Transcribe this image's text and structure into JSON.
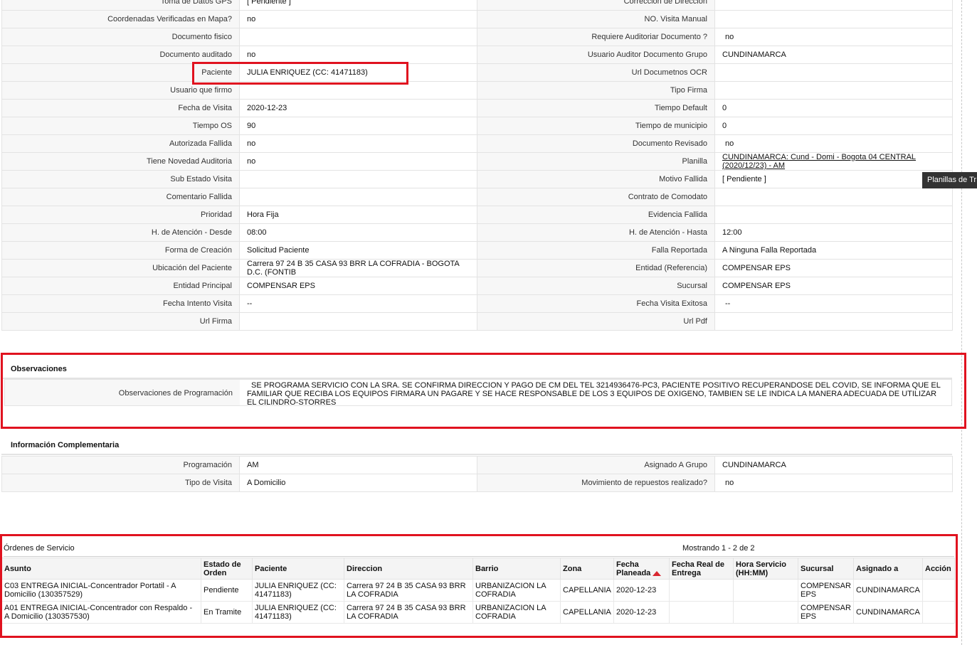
{
  "tooltip": "Planillas de Tr",
  "details": [
    [
      "Toma de Datos GPS",
      "[ Pendiente ]",
      "Corrección de Dirección",
      ""
    ],
    [
      "Coordenadas Verificadas en Mapa?",
      "no",
      "NO. Visita Manual",
      ""
    ],
    [
      "Documento fisico",
      "",
      "Requiere Auditoriar Documento ?",
      "no"
    ],
    [
      "Documento auditado",
      "no",
      "Usuario Auditor Documento Grupo",
      "CUNDINAMARCA"
    ],
    [
      "Paciente",
      "JULIA ENRIQUEZ (CC: 41471183)",
      "Url Documetnos OCR",
      ""
    ],
    [
      "Usuario que firmo",
      "",
      "Tipo Firma",
      ""
    ],
    [
      "Fecha de Visita",
      "2020-12-23",
      "Tiempo Default",
      "0"
    ],
    [
      "Tiempo OS",
      "90",
      "Tiempo de municipio",
      "0"
    ],
    [
      "Autorizada Fallida",
      "no",
      "Documento Revisado",
      "no"
    ],
    [
      "Tiene Novedad Auditoria",
      "no",
      "Planilla",
      "CUNDINAMARCA: Cund - Domi - Bogota 04 CENTRAL (2020/12/23) - AM"
    ],
    [
      "Sub Estado Visita",
      "",
      "Motivo Fallida",
      "[ Pendiente ]"
    ],
    [
      "Comentario Fallida",
      "",
      "Contrato de Comodato",
      ""
    ],
    [
      "Prioridad",
      "Hora Fija",
      "Evidencia Fallida",
      ""
    ],
    [
      "H. de Atención - Desde",
      "08:00",
      "H. de Atención - Hasta",
      "12:00"
    ],
    [
      "Forma de Creación",
      "Solicitud Paciente",
      "Falla Reportada",
      "A Ninguna Falla Reportada"
    ],
    [
      "Ubicación del Paciente",
      "Carrera 97 24 B 35 CASA 93 BRR LA COFRADIA - BOGOTA D.C. (FONTIB",
      "Entidad (Referencia)",
      "COMPENSAR EPS"
    ],
    [
      "Entidad Principal",
      "COMPENSAR EPS",
      "Sucursal",
      "COMPENSAR EPS"
    ],
    [
      "Fecha Intento Visita",
      "--",
      "Fecha Visita Exitosa",
      "--"
    ],
    [
      "Url Firma",
      "",
      "Url Pdf",
      ""
    ]
  ],
  "observaciones": {
    "title": "Observaciones",
    "label": "Observaciones de Programación",
    "value": "SE PROGRAMA SERVICIO CON LA SRA. SE CONFIRMA DIRECCION Y PAGO DE CM DEL TEL 3214936476-PC3, PACIENTE POSITIVO RECUPERANDOSE DEL COVID, SE INFORMA QUE EL FAMILIAR QUE RECIBA LOS EQUIPOS FIRMARA UN PAGARE Y SE HACE RESPONSABLE DE LOS 3 EQUIPOS DE OXIGENO, TAMBIEN SE LE INDICA LA MANERA ADECUADA DE UTILIZAR EL CILINDRO-STORRES"
  },
  "complementaria": {
    "title": "Información Complementaria",
    "rows": [
      [
        "Programación",
        "AM",
        "Asignado A Grupo",
        "CUNDINAMARCA"
      ],
      [
        "Tipo de Visita",
        "A Domicilio",
        "Movimiento de repuestos realizado?",
        "no"
      ]
    ]
  },
  "ordenes": {
    "title": "Órdenes de Servicio",
    "count": "Mostrando 1 - 2 de 2",
    "headers": [
      "Asunto",
      "Estado de Orden",
      "Paciente",
      "Direccion",
      "Barrio",
      "Zona",
      "Fecha Planeada",
      "Fecha Real de Entrega",
      "Hora Servicio (HH:MM)",
      "Sucursal",
      "Asignado a",
      "Acción"
    ],
    "rows": [
      [
        "C03 ENTREGA INICIAL-Concentrador Portatil - A Domicilio (130357529)",
        "Pendiente",
        "JULIA ENRIQUEZ (CC: 41471183)",
        "Carrera 97 24 B 35 CASA 93 BRR LA COFRADIA",
        "URBANIZACION LA COFRADIA",
        "CAPELLANIA",
        "2020-12-23",
        "",
        "",
        "COMPENSAR EPS",
        "CUNDINAMARCA",
        ""
      ],
      [
        "A01 ENTREGA INICIAL-Concentrador con Respaldo - A Domicilio (130357530)",
        "En Tramite",
        "JULIA ENRIQUEZ (CC: 41471183)",
        "Carrera 97 24 B 35 CASA 93 BRR LA COFRADIA",
        "URBANIZACION LA COFRADIA",
        "CAPELLANIA",
        "2020-12-23",
        "",
        "",
        "COMPENSAR EPS",
        "CUNDINAMARCA",
        ""
      ]
    ]
  }
}
